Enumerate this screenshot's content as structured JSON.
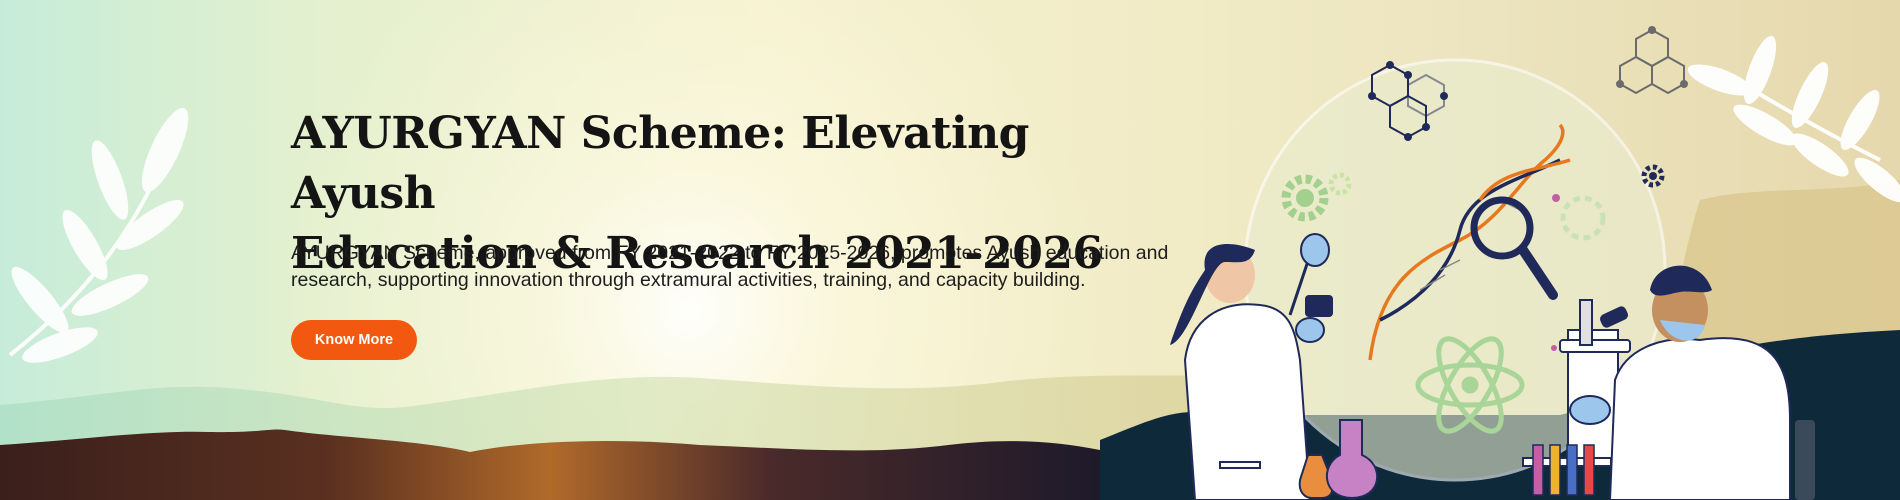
{
  "hero": {
    "title_line1": "AYURGYAN Scheme: Elevating Ayush",
    "title_line2": "Education & Research 2021-2026",
    "description_line1": "AYURGYAN Scheme, approved from FY 2021-2022 to FY 2025-2026, promotes Ayush education and",
    "description_line2": "research, supporting innovation through extramural activities, training, and capacity building.",
    "cta_label": "Know More"
  },
  "colors": {
    "accent": "#f2580f",
    "navy": "#1f2a5a",
    "dna_orange": "#e8781e",
    "mint_light": "#c6ecd9",
    "sand": "#e6d8ad"
  },
  "icons": [
    "leaf-branch-icon",
    "hexagon-molecule-icon",
    "gear-icon",
    "dna-helix-icon",
    "magnifier-icon",
    "atom-icon",
    "microscope-icon",
    "flask-icon",
    "test-tubes-icon"
  ]
}
